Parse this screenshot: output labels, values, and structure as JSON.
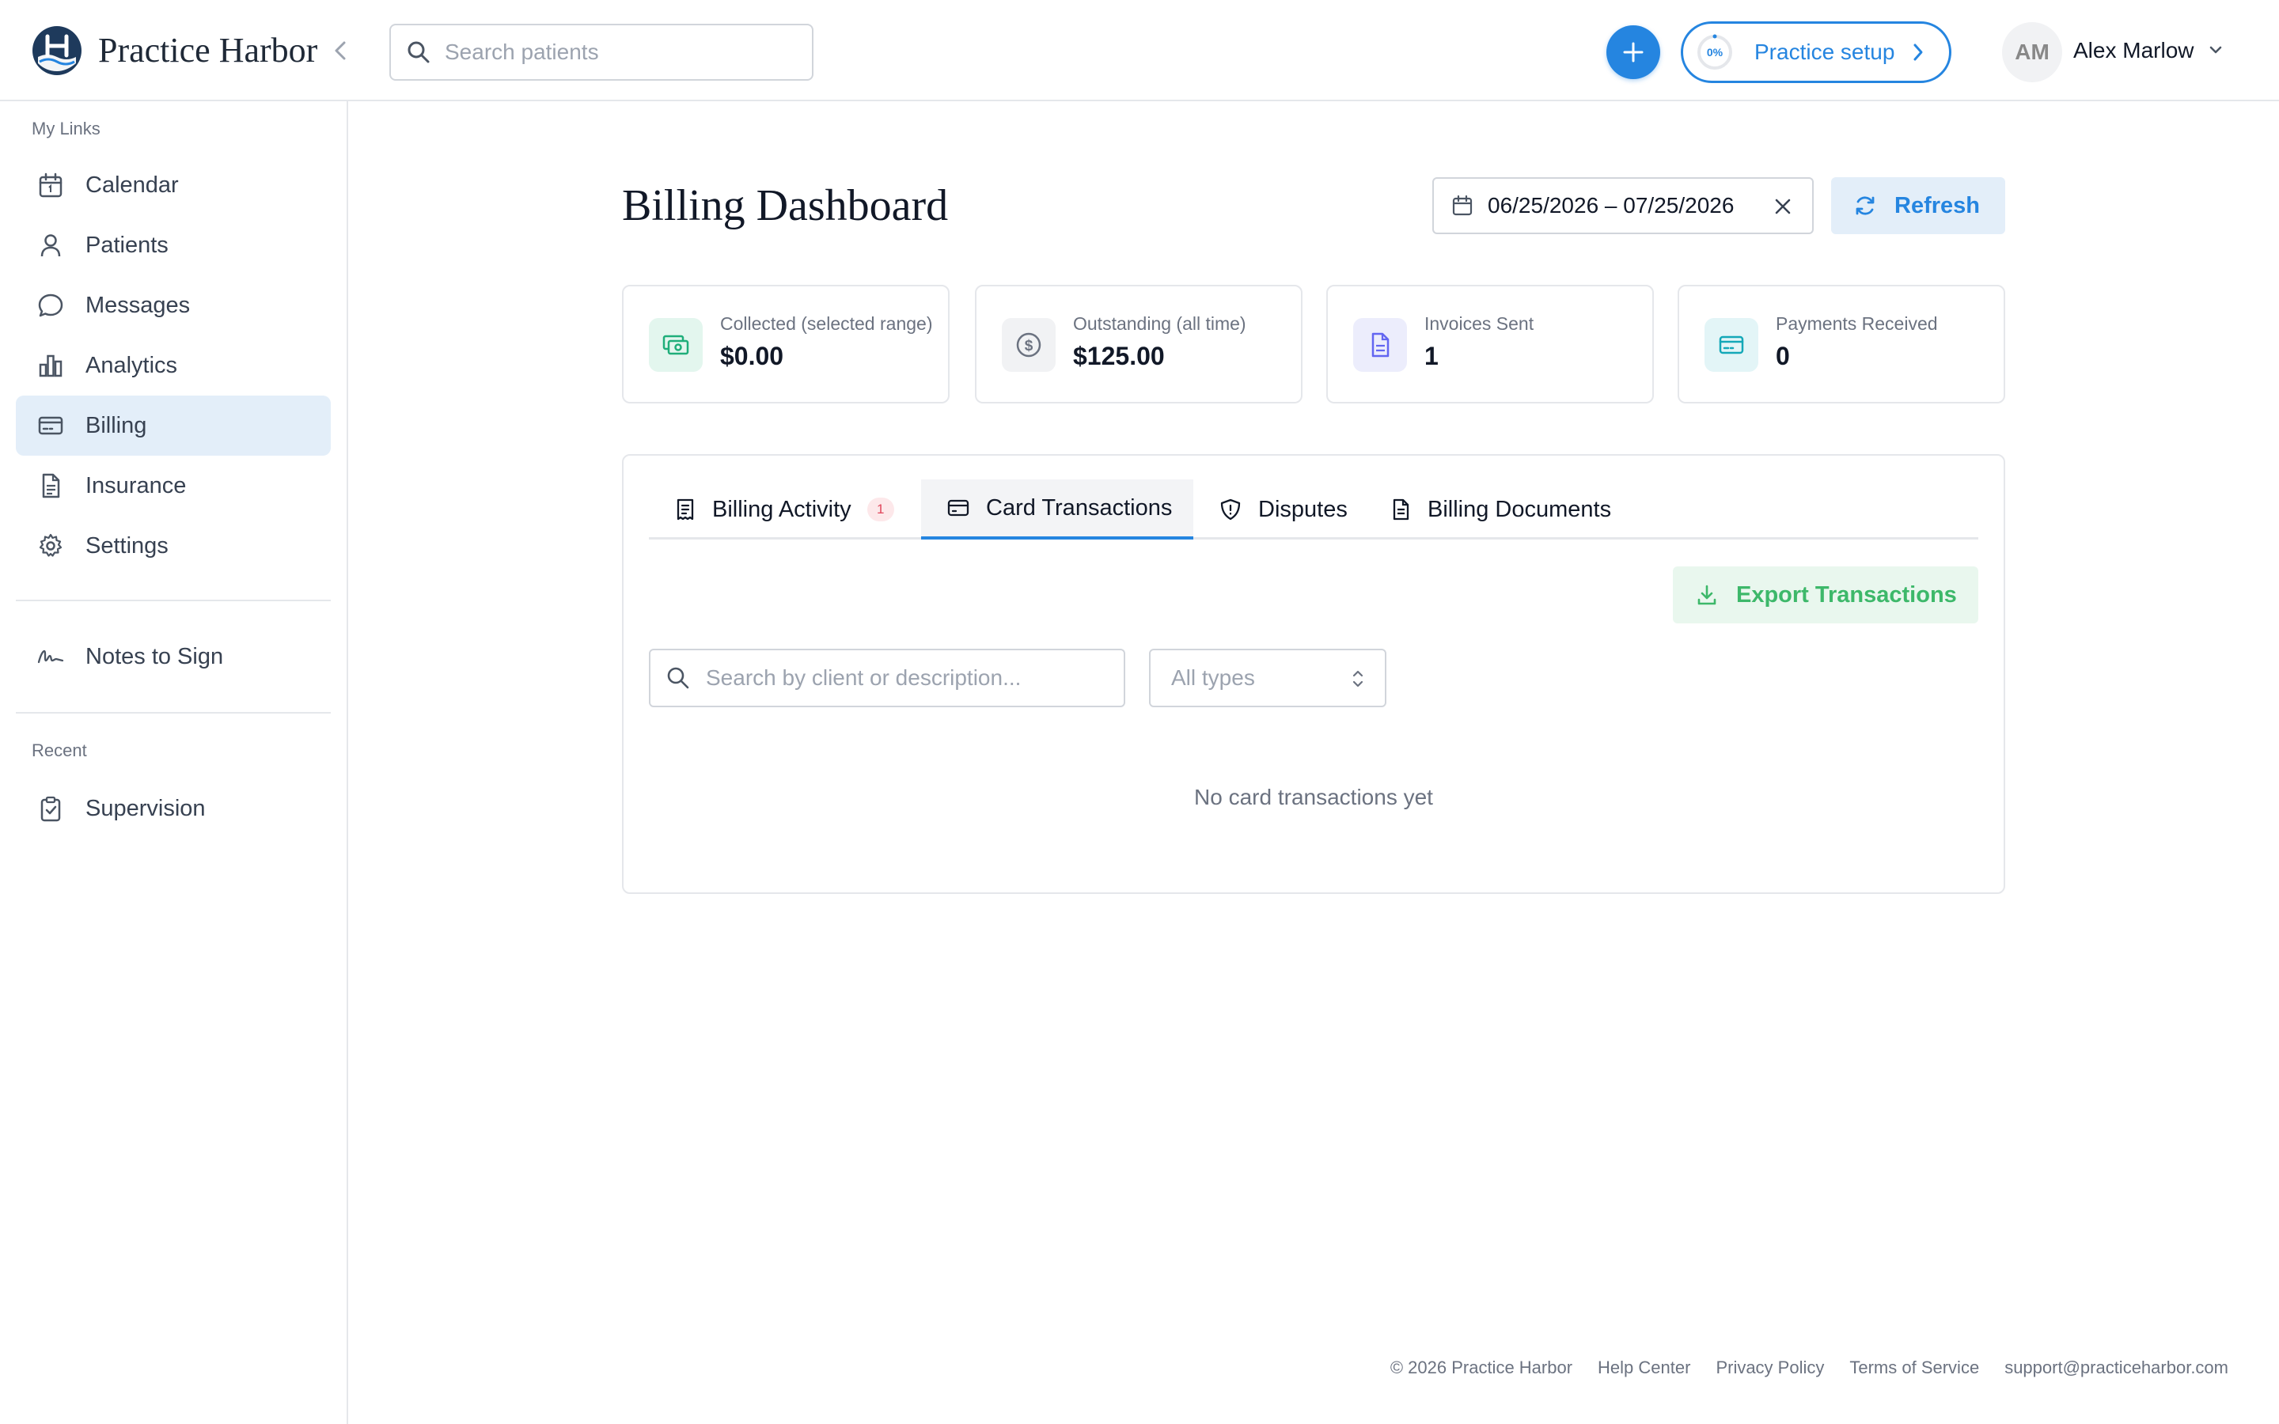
{
  "header": {
    "brand": "Practice Harbor",
    "search_placeholder": "Search patients",
    "setup_progress": "0%",
    "setup_label": "Practice setup",
    "user_initials": "AM",
    "user_name": "Alex Marlow"
  },
  "sidebar": {
    "my_links_label": "My Links",
    "items": [
      {
        "label": "Calendar",
        "icon": "calendar-icon"
      },
      {
        "label": "Patients",
        "icon": "person-icon"
      },
      {
        "label": "Messages",
        "icon": "chat-bubble-icon"
      },
      {
        "label": "Analytics",
        "icon": "bar-chart-icon"
      },
      {
        "label": "Billing",
        "icon": "credit-card-icon",
        "active": true
      },
      {
        "label": "Insurance",
        "icon": "document-icon"
      },
      {
        "label": "Settings",
        "icon": "gear-icon"
      }
    ],
    "notes_to_sign": "Notes to Sign",
    "recent_label": "Recent",
    "recent_items": [
      {
        "label": "Supervision",
        "icon": "clipboard-check-icon"
      }
    ]
  },
  "main": {
    "title": "Billing Dashboard",
    "date_range": "06/25/2026 – 07/25/2026",
    "refresh_label": "Refresh",
    "stats": [
      {
        "label": "Collected (selected range)",
        "value": "$0.00",
        "icon": "cash-icon",
        "color": "#1fae7a"
      },
      {
        "label": "Outstanding (all time)",
        "value": "$125.00",
        "icon": "dollar-circle-icon",
        "color": "#6b7280"
      },
      {
        "label": "Invoices Sent",
        "value": "1",
        "icon": "invoice-icon",
        "color": "#6366f1"
      },
      {
        "label": "Payments Received",
        "value": "0",
        "icon": "card-icon",
        "color": "#14a8b8"
      }
    ],
    "tabs": [
      {
        "label": "Billing Activity",
        "count": "1",
        "icon": "receipt-icon"
      },
      {
        "label": "Card Transactions",
        "icon": "credit-card-icon",
        "active": true
      },
      {
        "label": "Disputes",
        "icon": "shield-icon"
      },
      {
        "label": "Billing Documents",
        "icon": "document-icon"
      }
    ],
    "export_label": "Export Transactions",
    "tx_search_placeholder": "Search by client or description...",
    "type_filter": "All types",
    "empty_message": "No card transactions yet"
  },
  "footer": {
    "copyright": "© 2026 Practice Harbor",
    "links": [
      "Help Center",
      "Privacy Policy",
      "Terms of Service",
      "support@practiceharbor.com"
    ]
  },
  "colors": {
    "accent": "#2585e0",
    "success": "#3db86a",
    "active_bg": "#e3eef9"
  }
}
